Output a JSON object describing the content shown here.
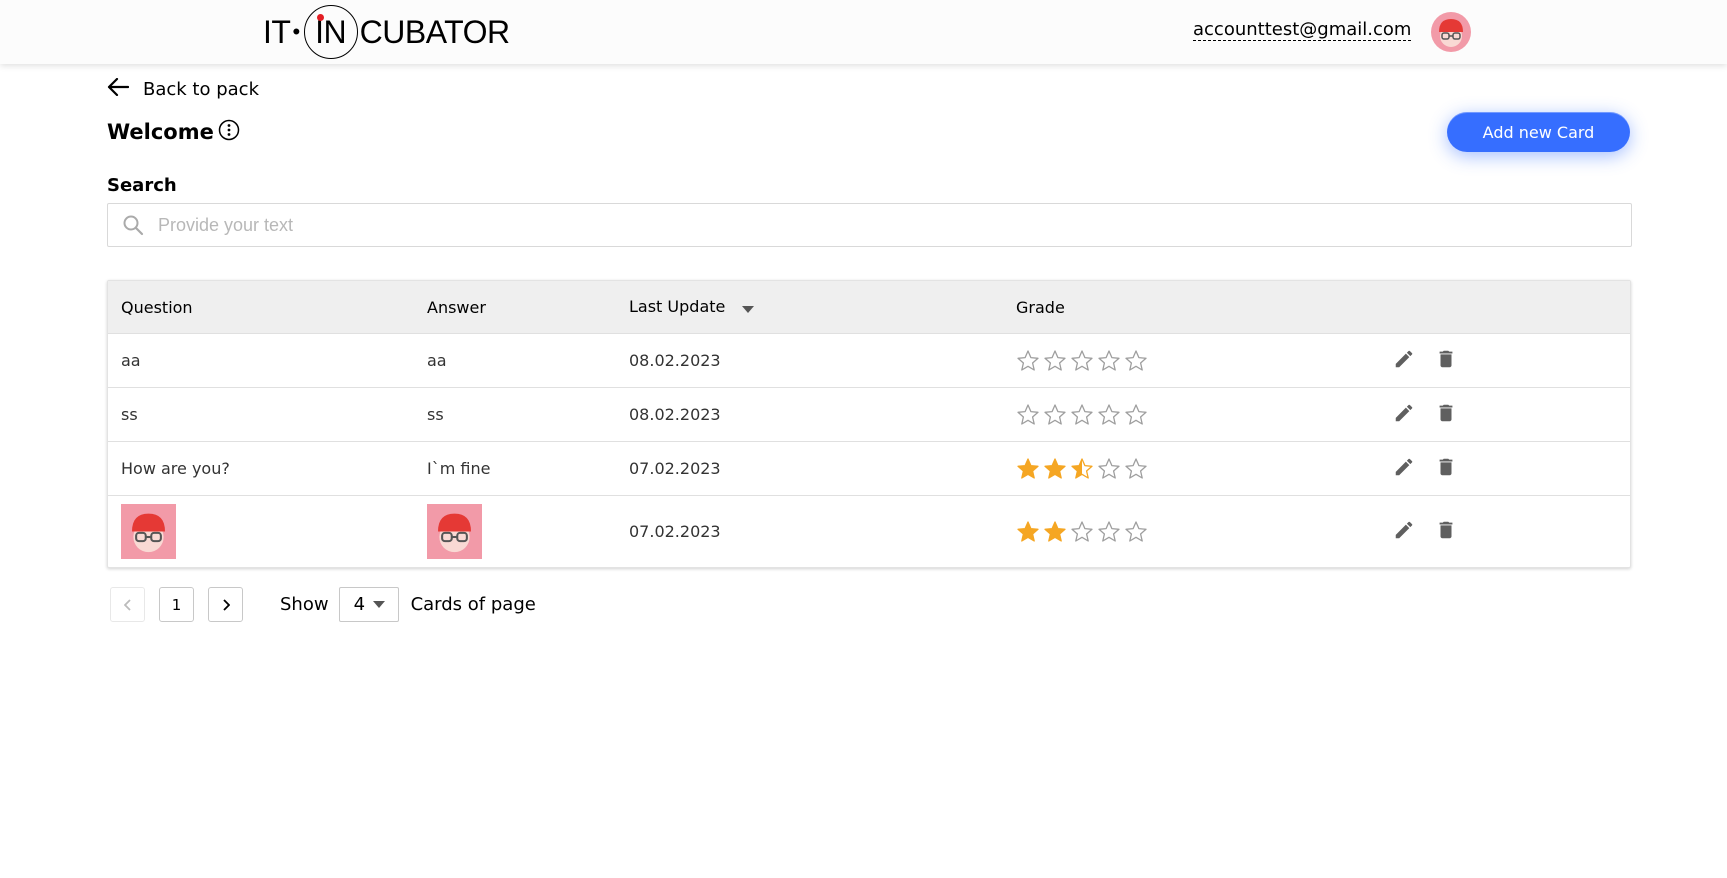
{
  "header": {
    "logo": {
      "left": "IT",
      "center": "IN",
      "right": "CUBATOR"
    },
    "email": "accounttest@gmail.com",
    "avatar_icon": "avatar-icon"
  },
  "nav": {
    "back_label": "Back to pack"
  },
  "pack": {
    "title": "Welcome",
    "info_icon": "info-icon"
  },
  "actions": {
    "add_card_label": "Add new Card",
    "accent_color": "#366eff"
  },
  "search": {
    "label": "Search",
    "placeholder": "Provide your text",
    "value": ""
  },
  "table": {
    "columns": {
      "question": "Question",
      "answer": "Answer",
      "last_update": "Last Update",
      "grade": "Grade"
    },
    "sort": {
      "column": "Last Update",
      "direction": "desc"
    },
    "rows": [
      {
        "question": "aa",
        "answer": "aa",
        "last_update": "08.02.2023",
        "grade": 0
      },
      {
        "question": "ss",
        "answer": "ss",
        "last_update": "08.02.2023",
        "grade": 0
      },
      {
        "question": "How are you?",
        "answer": "I`m fine",
        "last_update": "07.02.2023",
        "grade": 2.5
      },
      {
        "question": "[image]",
        "answer": "[image]",
        "last_update": "07.02.2023",
        "grade": 2
      }
    ],
    "star_color": "#f5a623"
  },
  "pagination": {
    "current_page": "1",
    "show_label": "Show",
    "page_size": "4",
    "cards_label": "Cards of page"
  }
}
